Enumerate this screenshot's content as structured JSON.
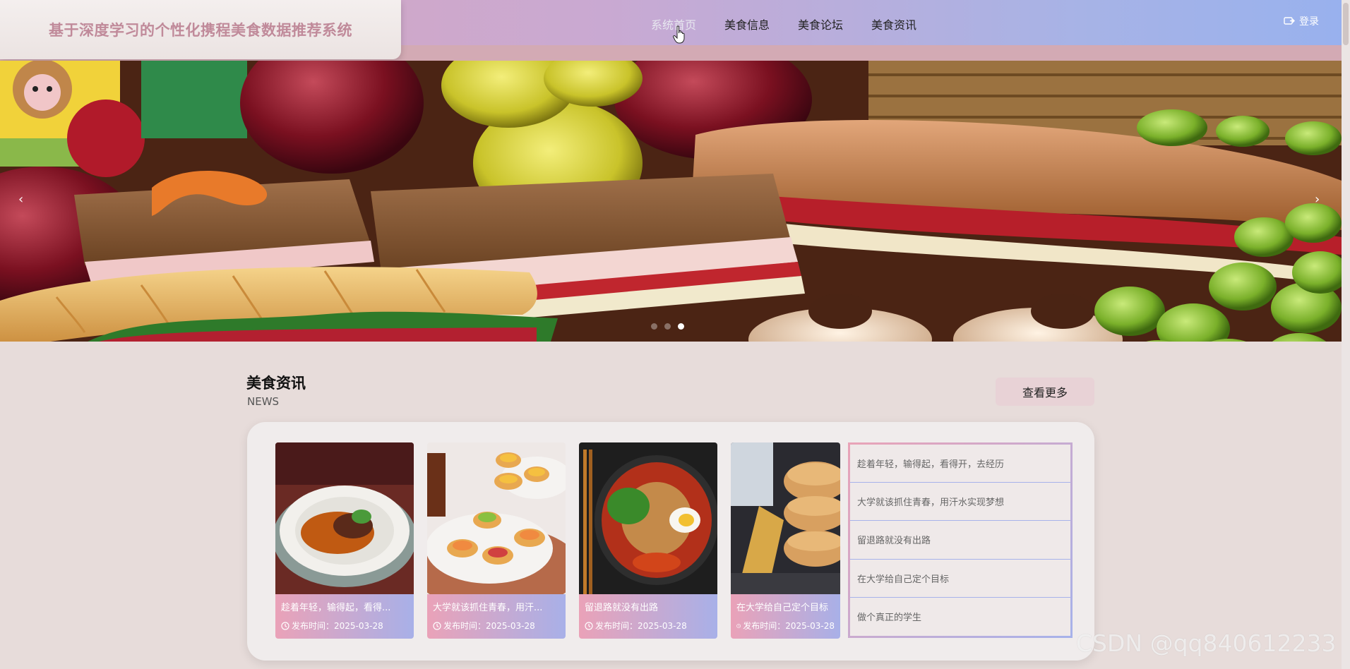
{
  "header": {
    "title": "基于深度学习的个性化携程美食数据推荐系统",
    "nav": [
      "系统首页",
      "美食信息",
      "美食论坛",
      "美食资讯"
    ],
    "active_nav": "系统首页",
    "login_label": "登录",
    "login_icon": "login-icon"
  },
  "banner": {
    "prev_icon": "‹",
    "next_icon": "›",
    "slide_count": 3,
    "active_slide": 3
  },
  "news": {
    "title": "美食资讯",
    "subtitle": "NEWS",
    "more_label": "查看更多",
    "cards": [
      {
        "title": "趁着年轻，输得起，看得开，去经历",
        "title_display": "趁着年轻，输得起，看得...",
        "date": "发布时间：2025-03-28"
      },
      {
        "title": "大学就该抓住青春，用汗水实现梦想",
        "title_display": "大学就该抓住青春，用汗...",
        "date": "发布时间：2025-03-28"
      },
      {
        "title": "留退路就没有出路",
        "title_display": "留退路就没有出路",
        "date": "发布时间：2025-03-28"
      },
      {
        "title": "在大学给自己定个目标",
        "title_display": "在大学给自己定个目标",
        "date": "发布时间：2025-03-28"
      }
    ],
    "list": [
      "趁着年轻，输得起，看得开，去经历",
      "大学就该抓住青春，用汗水实现梦想",
      "留退路就没有出路",
      "在大学给自己定个目标",
      "做个真正的学生"
    ]
  },
  "watermark": "CSDN @qq840612233",
  "colors": {
    "header_gradient_start": "#d9a7bb",
    "header_gradient_end": "#98b1ee",
    "brand_text": "#c08a9a",
    "card_info_start": "#eaa2b8",
    "card_info_end": "#a8b0e8",
    "page_bg": "#e7dcda"
  }
}
